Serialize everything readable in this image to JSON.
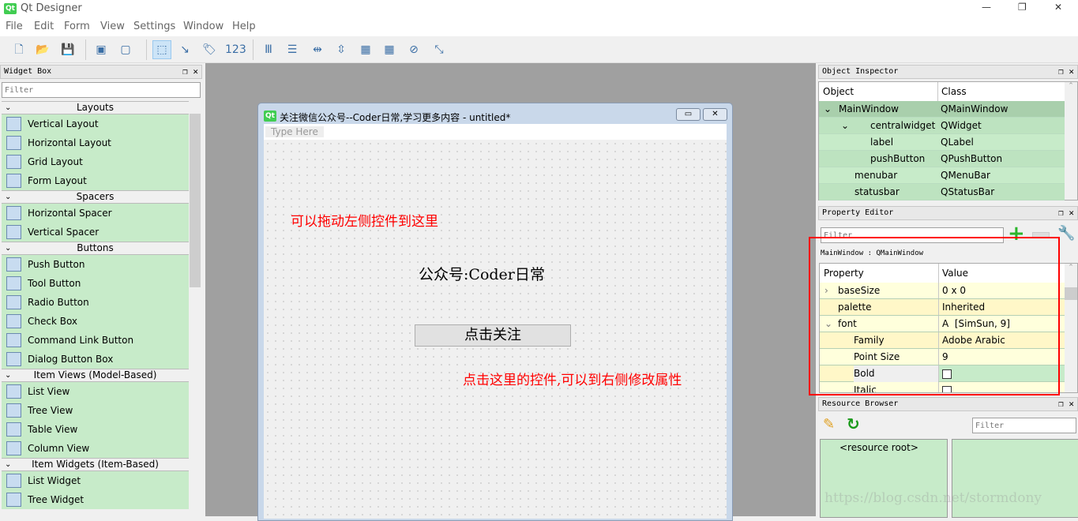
{
  "app": {
    "title": "Qt Designer",
    "logo": "Qt"
  },
  "window_controls": {
    "minimize": "—",
    "maximize": "❐",
    "close": "✕"
  },
  "menu": [
    "File",
    "Edit",
    "Form",
    "View",
    "Settings",
    "Window",
    "Help"
  ],
  "toolbar": [
    {
      "icon": "new-file-icon"
    },
    {
      "icon": "open-folder-icon"
    },
    {
      "icon": "save-icon"
    },
    {
      "icon": "bring-to-front-icon"
    },
    {
      "icon": "send-to-back-icon"
    },
    {
      "icon": "edit-widgets-icon",
      "active": true
    },
    {
      "icon": "edit-signals-slots-icon"
    },
    {
      "icon": "edit-buddies-icon"
    },
    {
      "icon": "edit-tab-order-icon"
    },
    {
      "icon": "layout-horizontal-icon"
    },
    {
      "icon": "layout-vertical-icon"
    },
    {
      "icon": "layout-h-splitter-icon"
    },
    {
      "icon": "layout-v-splitter-icon"
    },
    {
      "icon": "layout-grid-icon"
    },
    {
      "icon": "layout-form-icon"
    },
    {
      "icon": "break-layout-icon"
    },
    {
      "icon": "adjust-size-icon"
    }
  ],
  "widget_box": {
    "title": "Widget Box",
    "filter_placeholder": "Filter",
    "categories": [
      {
        "name": "Layouts",
        "items": [
          "Vertical Layout",
          "Horizontal Layout",
          "Grid Layout",
          "Form Layout"
        ]
      },
      {
        "name": "Spacers",
        "items": [
          "Horizontal Spacer",
          "Vertical Spacer"
        ]
      },
      {
        "name": "Buttons",
        "items": [
          "Push Button",
          "Tool Button",
          "Radio Button",
          "Check Box",
          "Command Link Button",
          "Dialog Button Box"
        ]
      },
      {
        "name": "Item Views (Model-Based)",
        "items": [
          "List View",
          "Tree View",
          "Table View",
          "Column View"
        ]
      },
      {
        "name": "Item Widgets (Item-Based)",
        "items": [
          "List Widget",
          "Tree Widget"
        ]
      }
    ]
  },
  "form": {
    "title": "关注微信公众号--Coder日常,学习更多内容 - untitled*",
    "menu_placeholder": "Type Here",
    "label_text": "公众号:Coder日常",
    "button_text": "点击关注",
    "annotation_drag": "可以拖动左侧控件到这里",
    "annotation_click": "点击这里的控件,可以到右侧修改属性",
    "annotation_color": "#ff0000"
  },
  "object_inspector": {
    "title": "Object Inspector",
    "headers": [
      "Object",
      "Class"
    ],
    "rows": [
      {
        "object": "MainWindow",
        "class": "QMainWindow",
        "depth": 0,
        "expanded": true,
        "selected": true
      },
      {
        "object": "centralwidget",
        "class": "QWidget",
        "depth": 1,
        "expanded": true
      },
      {
        "object": "label",
        "class": "QLabel",
        "depth": 2
      },
      {
        "object": "pushButton",
        "class": "QPushButton",
        "depth": 2
      },
      {
        "object": "menubar",
        "class": "QMenuBar",
        "depth": 1
      },
      {
        "object": "statusbar",
        "class": "QStatusBar",
        "depth": 1
      }
    ]
  },
  "property_editor": {
    "title": "Property Editor",
    "filter_placeholder": "Filter",
    "context": "MainWindow : QMainWindow",
    "headers": [
      "Property",
      "Value"
    ],
    "rows": [
      {
        "name": "baseSize",
        "value": "0 x 0",
        "arrow": "›",
        "depth": 0
      },
      {
        "name": "palette",
        "value": "Inherited",
        "depth": 0
      },
      {
        "name": "font",
        "value": "[SimSun, 9]",
        "arrow": "⌄",
        "depth": 0
      },
      {
        "name": "Family",
        "value": "Adobe Arabic",
        "depth": 1
      },
      {
        "name": "Point Size",
        "value": "9",
        "depth": 1
      },
      {
        "name": "Bold",
        "value": "",
        "checkbox": true,
        "depth": 1,
        "selected": true
      },
      {
        "name": "Italic",
        "value": "",
        "checkbox": true,
        "depth": 1
      }
    ]
  },
  "resource_browser": {
    "title": "Resource Browser",
    "filter_placeholder": "Filter",
    "root": "<resource root>"
  },
  "watermark": "https://blog.csdn.net/stormdony"
}
